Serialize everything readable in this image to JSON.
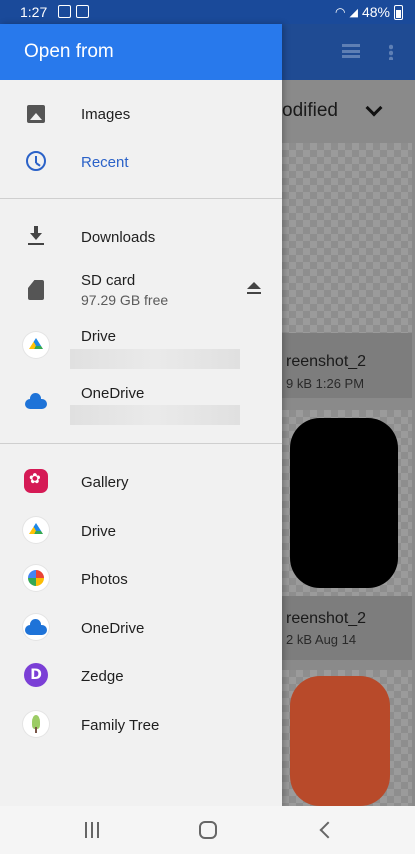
{
  "status_bar": {
    "time": "1:27",
    "battery": "48%"
  },
  "background": {
    "sort_label": "odified",
    "files": [
      {
        "name": "reenshot_2",
        "meta": "9 kB 1:26 PM"
      },
      {
        "name": "reenshot_2",
        "meta": "2 kB Aug 14"
      }
    ]
  },
  "drawer": {
    "title": "Open from",
    "section1": [
      {
        "label": "Images",
        "icon": "image-icon"
      },
      {
        "label": "Recent",
        "icon": "clock-icon",
        "active": true
      }
    ],
    "section2": [
      {
        "label": "Downloads",
        "icon": "download-icon"
      },
      {
        "label": "SD card",
        "sublabel": "97.29 GB free",
        "icon": "sd-card-icon"
      },
      {
        "label": "Drive",
        "icon": "google-drive-icon"
      },
      {
        "label": "OneDrive",
        "icon": "onedrive-icon"
      }
    ],
    "section3": [
      {
        "label": "Gallery",
        "icon": "gallery-icon"
      },
      {
        "label": "Drive",
        "icon": "google-drive-icon"
      },
      {
        "label": "Photos",
        "icon": "google-photos-icon"
      },
      {
        "label": "OneDrive",
        "icon": "onedrive-icon"
      },
      {
        "label": "Zedge",
        "icon": "zedge-icon"
      },
      {
        "label": "Family Tree",
        "icon": "family-tree-icon"
      }
    ]
  },
  "colors": {
    "accent": "#2879ec",
    "active": "#2b62c8"
  }
}
